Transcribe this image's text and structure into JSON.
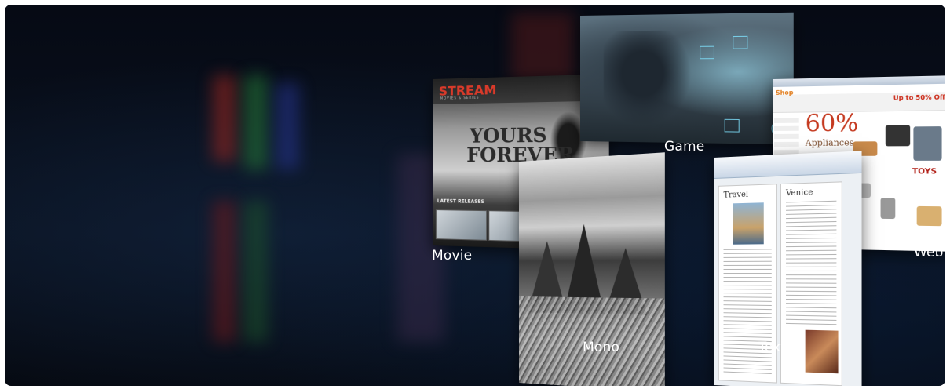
{
  "showcase": {
    "labels": {
      "movie": "Movie",
      "game": "Game",
      "web": "Web",
      "mono": "Mono",
      "text": "Text"
    },
    "movie_panel": {
      "logo": "STREAM",
      "logo_sub": "MOVIES & SERIES",
      "hero_line1": "YOURS",
      "hero_line2": "FOREVER",
      "section": "LATEST RELEASES"
    },
    "web_panel": {
      "shop": "Shop",
      "promo_number": "60%",
      "promo_text": "Appliances",
      "upto": "Up to 50% Off",
      "toys": "TOYS"
    },
    "doc_panel": {
      "page1_heading": "Travel",
      "page2_heading": "Venice"
    }
  },
  "colors": {
    "background": "#060a14",
    "label": "#ffffff",
    "movie_logo": "#d93a2a",
    "hud": "#7fe3ff"
  }
}
